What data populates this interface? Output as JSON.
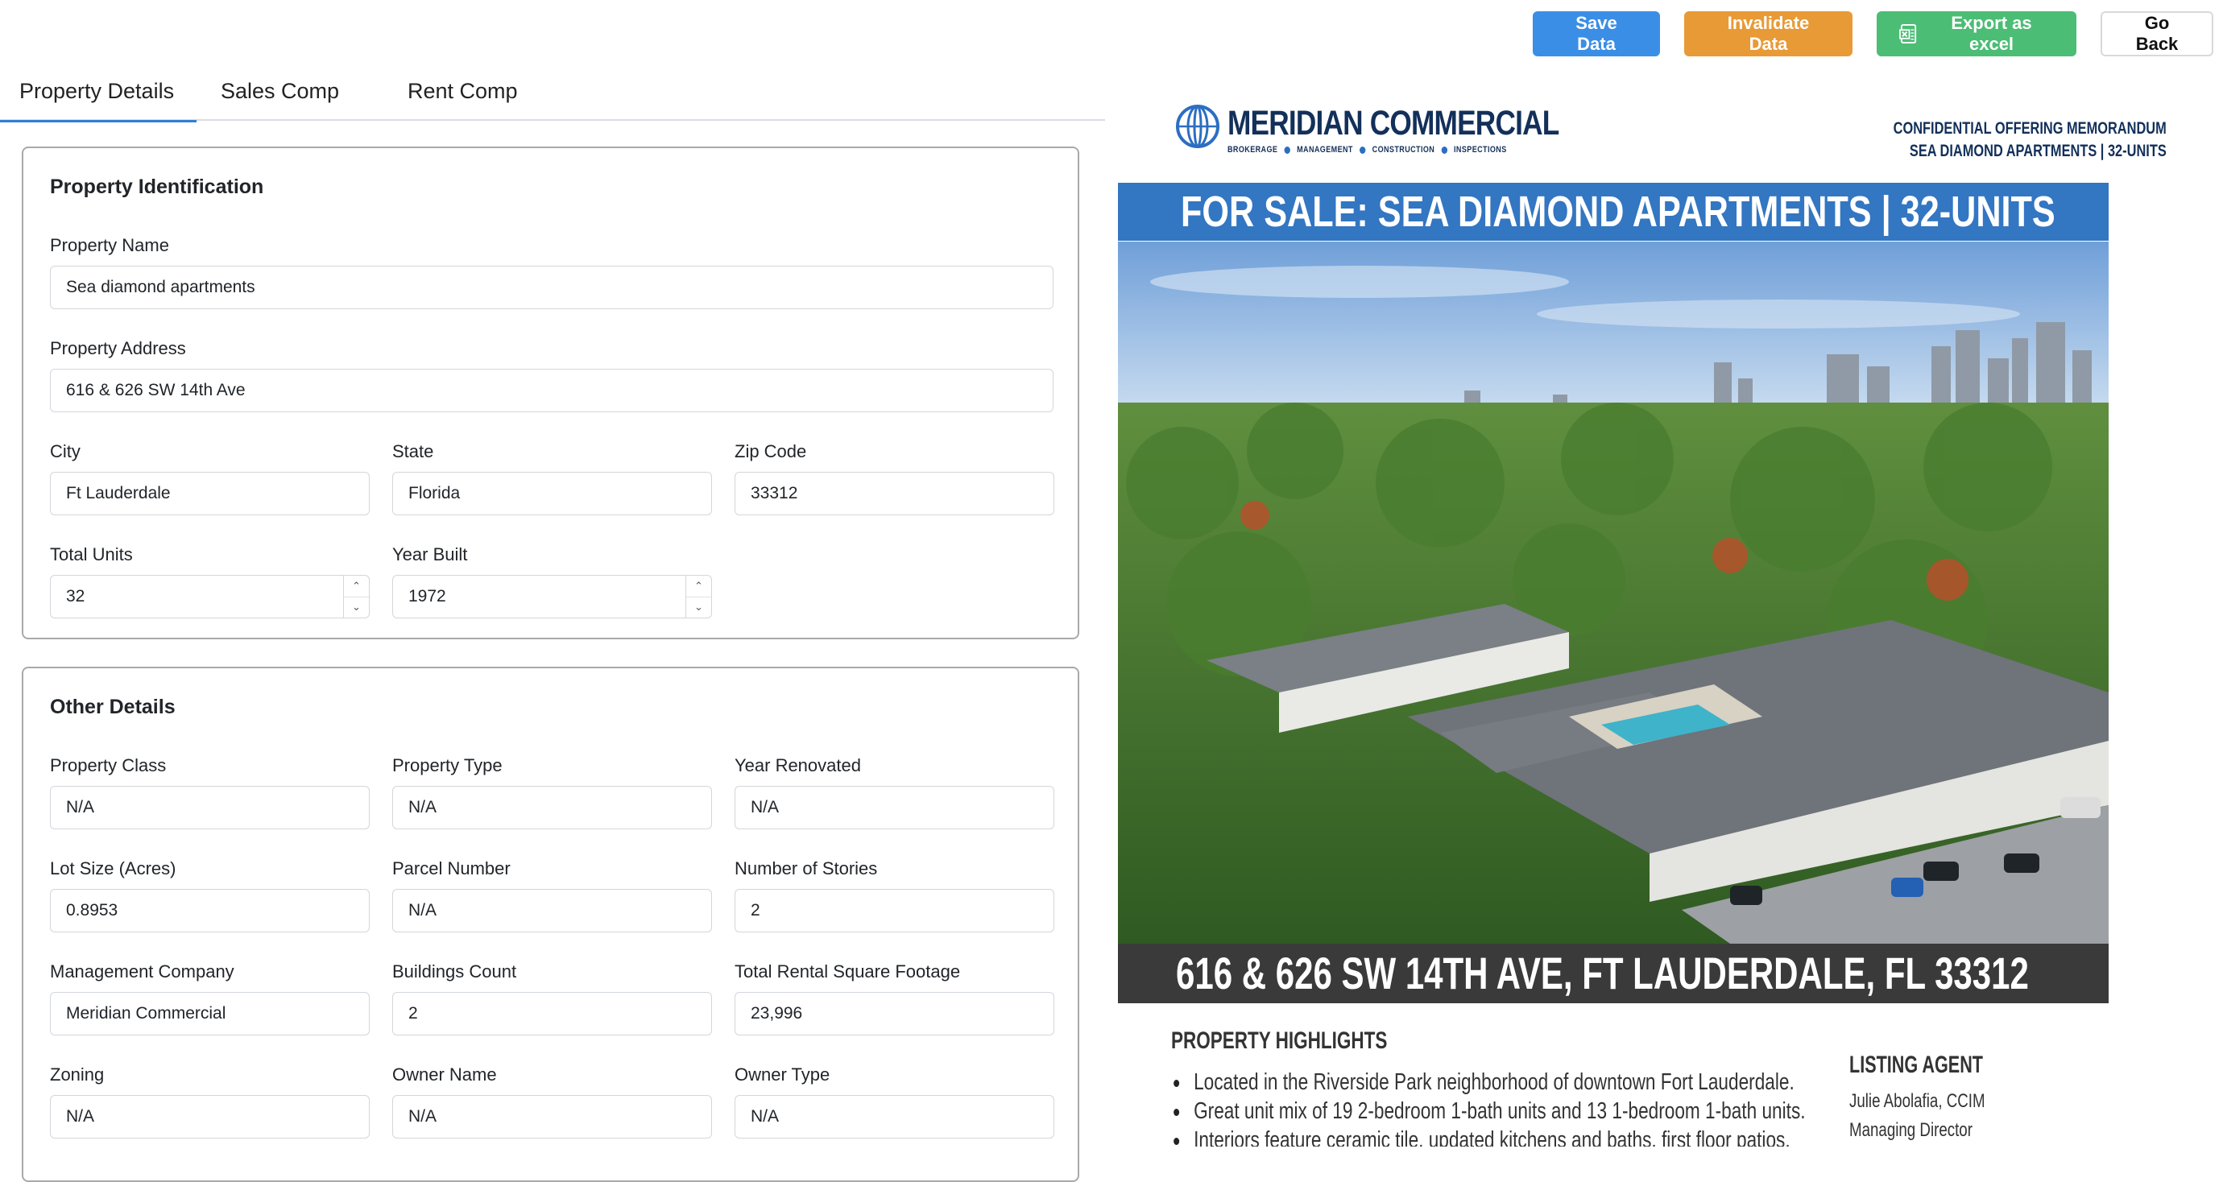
{
  "toolbar": {
    "save_label": "Save Data",
    "invalidate_label": "Invalidate Data",
    "export_label": "Export as excel",
    "back_label": "Go Back",
    "colors": {
      "save": "#3b8ee5",
      "invalidate": "#e89a36",
      "export": "#4cbd75"
    }
  },
  "tabs": [
    {
      "label": "Property Details",
      "active": true
    },
    {
      "label": "Sales Comp",
      "active": false
    },
    {
      "label": "Rent Comp",
      "active": false
    }
  ],
  "identification": {
    "title": "Property Identification",
    "property_name": {
      "label": "Property Name",
      "value": "Sea diamond apartments"
    },
    "property_address": {
      "label": "Property Address",
      "value": "616 & 626 SW 14th Ave"
    },
    "city": {
      "label": "City",
      "value": "Ft Lauderdale"
    },
    "state": {
      "label": "State",
      "value": "Florida"
    },
    "zip": {
      "label": "Zip Code",
      "value": "33312"
    },
    "total_units": {
      "label": "Total Units",
      "value": "32"
    },
    "year_built": {
      "label": "Year Built",
      "value": "1972"
    }
  },
  "other": {
    "title": "Other Details",
    "property_class": {
      "label": "Property Class",
      "value": "N/A"
    },
    "property_type": {
      "label": "Property Type",
      "value": "N/A"
    },
    "year_renovated": {
      "label": "Year Renovated",
      "value": "N/A"
    },
    "lot_size": {
      "label": "Lot Size (Acres)",
      "value": "0.8953"
    },
    "parcel_number": {
      "label": "Parcel Number",
      "value": "N/A"
    },
    "stories": {
      "label": "Number of Stories",
      "value": "2"
    },
    "management_company": {
      "label": "Management Company",
      "value": "Meridian Commercial"
    },
    "buildings_count": {
      "label": "Buildings Count",
      "value": "2"
    },
    "rental_sqft": {
      "label": "Total Rental Square Footage",
      "value": "23,996"
    },
    "zoning": {
      "label": "Zoning",
      "value": "N/A"
    },
    "owner_name": {
      "label": "Owner Name",
      "value": "N/A"
    },
    "owner_type": {
      "label": "Owner Type",
      "value": "N/A"
    }
  },
  "document": {
    "logo_name": "MERIDIAN COMMERCIAL",
    "logo_services": [
      "BROKERAGE",
      "MANAGEMENT",
      "CONSTRUCTION",
      "INSPECTIONS"
    ],
    "conf_line1": "CONFIDENTIAL OFFERING MEMORANDUM",
    "conf_line2": "SEA DIAMOND APARTMENTS | 32-UNITS",
    "banner": "FOR SALE:  SEA DIAMOND APARTMENTS | 32-UNITS",
    "address": "616 & 626 SW 14TH AVE, FT LAUDERDALE, FL 33312",
    "highlights_title": "PROPERTY HIGHLIGHTS",
    "highlights": [
      "Located in the Riverside Park neighborhood of downtown Fort Lauderdale.",
      "Great unit mix of 19 2-bedroom 1-bath units and 13 1-bedroom 1-bath units.",
      "Interiors feature ceramic tile, updated kitchens and baths, first floor patios."
    ],
    "agent_title": "LISTING AGENT",
    "agent_name": "Julie Abolafia, CCIM",
    "agent_role": "Managing Director",
    "colors": {
      "navy": "#13305a",
      "banner_blue": "#3376c2",
      "address_bar": "#3a3a3a"
    }
  }
}
